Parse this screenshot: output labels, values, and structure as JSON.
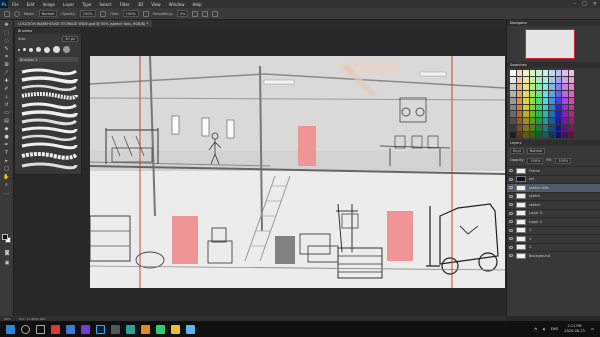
{
  "app": {
    "logo": "Ps",
    "menus": [
      "File",
      "Edit",
      "Image",
      "Layer",
      "Type",
      "Select",
      "Filter",
      "3D",
      "View",
      "Window",
      "Help"
    ],
    "window_controls": [
      "–",
      "□",
      "✕"
    ]
  },
  "options": {
    "mode_label": "Mode:",
    "mode_value": "Normal",
    "opacity_label": "Opacity:",
    "opacity_value": "100%",
    "flow_label": "Flow:",
    "flow_value": "100%",
    "smoothing_label": "Smoothing:",
    "smoothing_value": "0%"
  },
  "document": {
    "tab_title": "LOCATION WAREHOUSE STORAGE WIDE.psd @ 50% (sketch fails, RGB/8) *"
  },
  "brushes": {
    "title": "Brushes",
    "size_label": "Size:",
    "size_value": "10 px",
    "folder_label": "Brushes 1"
  },
  "navigator": {
    "title": "Navigator"
  },
  "swatches": {
    "title": "Swatches"
  },
  "layers": {
    "title": "Layers",
    "kind_label": "Kind",
    "blend_value": "Normal",
    "opacity_label": "Opacity:",
    "opacity_value": "100%",
    "fill_label": "Fill:",
    "fill_value": "100%",
    "items": [
      {
        "name": "Frame",
        "thumb": "light",
        "active": false
      },
      {
        "name": "ref",
        "thumb": "dark",
        "active": false
      },
      {
        "name": "sketch fails",
        "thumb": "light",
        "active": true
      },
      {
        "name": "sketch",
        "thumb": "light",
        "active": false
      },
      {
        "name": "sketch",
        "thumb": "light",
        "active": false
      },
      {
        "name": "Layer 5",
        "thumb": "light",
        "active": false
      },
      {
        "name": "Layer 2",
        "thumb": "light",
        "active": false
      },
      {
        "name": "1",
        "thumb": "light",
        "active": false
      },
      {
        "name": "1",
        "thumb": "light",
        "active": false
      },
      {
        "name": "1",
        "thumb": "light",
        "active": false
      },
      {
        "name": "Background",
        "thumb": "light",
        "active": false
      }
    ]
  },
  "status": {
    "zoom": "50%",
    "doc_info": "Doc: 11.4M/1.06G"
  },
  "taskbar": {
    "language": "ENG",
    "time": "2:11 PM",
    "date": "2020-08-13"
  },
  "colors": {
    "accent_red": "#e06060",
    "guide_red": "#c0392b",
    "active_layer": "#4d5b6a"
  }
}
